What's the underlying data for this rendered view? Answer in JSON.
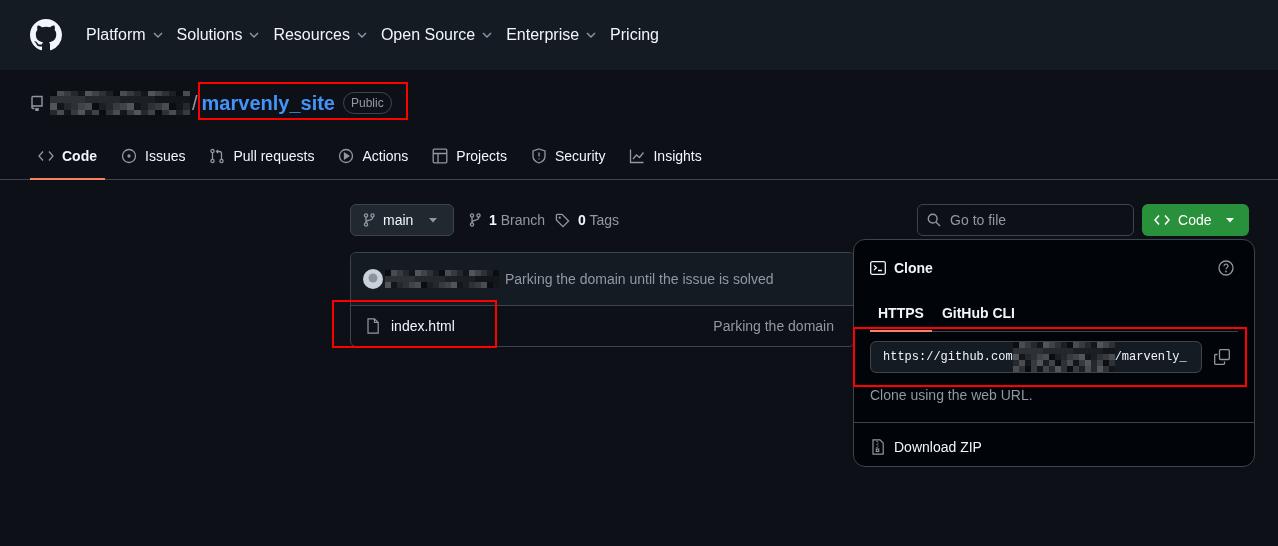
{
  "nav": [
    {
      "label": "Platform",
      "dropdown": true
    },
    {
      "label": "Solutions",
      "dropdown": true
    },
    {
      "label": "Resources",
      "dropdown": true
    },
    {
      "label": "Open Source",
      "dropdown": true
    },
    {
      "label": "Enterprise",
      "dropdown": true
    },
    {
      "label": "Pricing",
      "dropdown": false
    }
  ],
  "repo": {
    "separator": "/",
    "name": "marvenly_site",
    "visibility": "Public"
  },
  "tabs": [
    {
      "label": "Code",
      "selected": true
    },
    {
      "label": "Issues",
      "selected": false
    },
    {
      "label": "Pull requests",
      "selected": false
    },
    {
      "label": "Actions",
      "selected": false
    },
    {
      "label": "Projects",
      "selected": false
    },
    {
      "label": "Security",
      "selected": false
    },
    {
      "label": "Insights",
      "selected": false
    }
  ],
  "toolbar": {
    "branch": "main",
    "branch_count": "1",
    "branch_label": "Branch",
    "tag_count": "0",
    "tag_label": "Tags",
    "search_placeholder": "Go to file",
    "code_button": "Code"
  },
  "commit": {
    "message": "Parking the domain until the issue is solved"
  },
  "files": [
    {
      "name": "index.html",
      "message": "Parking the domain"
    }
  ],
  "clone_popover": {
    "title": "Clone",
    "tabs": [
      {
        "label": "HTTPS",
        "selected": true
      },
      {
        "label": "GitHub CLI",
        "selected": false
      }
    ],
    "url_start": "https://github.com",
    "url_end": "/marvenly_",
    "hint": "Clone using the web URL.",
    "download": "Download ZIP"
  }
}
